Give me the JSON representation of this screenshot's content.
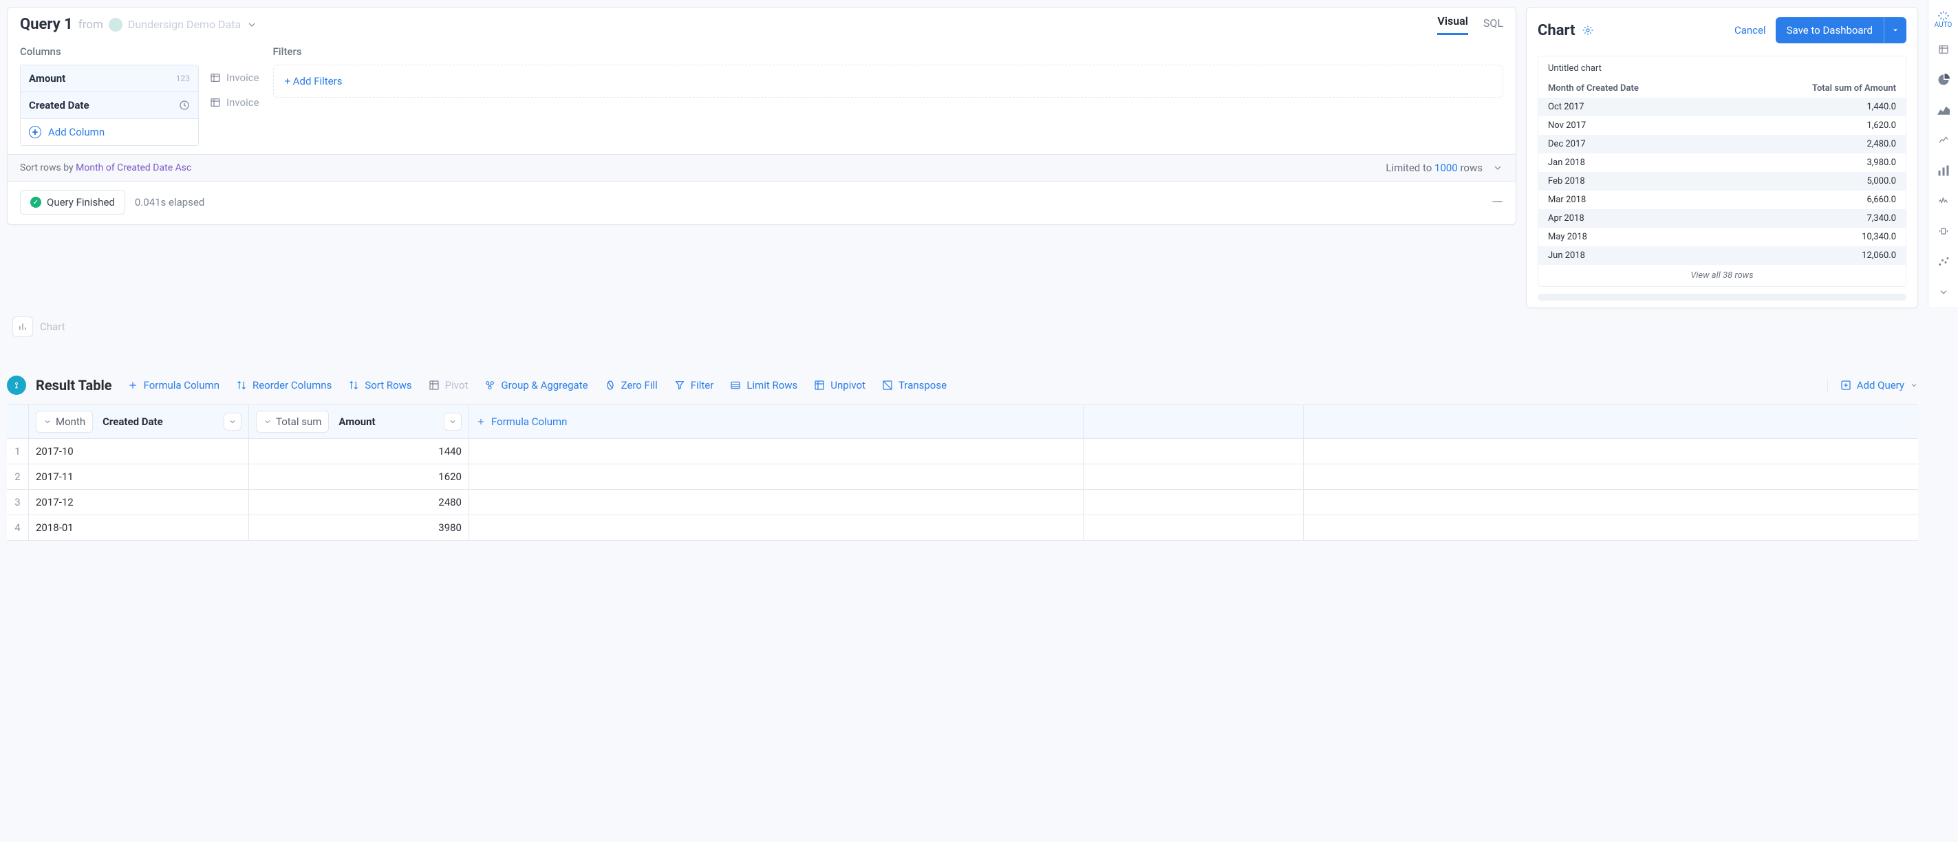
{
  "query_panel": {
    "title": "Query 1",
    "from_label": "from",
    "source": "Dundersign Demo Data",
    "tabs": {
      "visual": "Visual",
      "sql": "SQL"
    },
    "columns_label": "Columns",
    "filters_label": "Filters",
    "add_filters": "+ Add Filters",
    "columns": [
      {
        "name": "Amount",
        "type": "123",
        "table": "Invoice"
      },
      {
        "name": "Created Date",
        "type": "clock",
        "table": "Invoice"
      }
    ],
    "add_column": "Add Column",
    "sort": {
      "prefix": "Sort rows by",
      "field": "Month of Created Date",
      "dir": "Asc"
    },
    "limit": {
      "prefix": "Limited to",
      "n": "1000",
      "suffix": "rows"
    },
    "status": {
      "text": "Query Finished",
      "elapsed": "0.041s elapsed"
    }
  },
  "chart_chip": {
    "label": "Chart"
  },
  "chart_panel": {
    "title": "Chart",
    "cancel": "Cancel",
    "save": "Save to Dashboard",
    "untitled": "Untitled chart",
    "col1": "Month of Created Date",
    "col2": "Total sum of Amount",
    "rows": [
      {
        "m": "Oct 2017",
        "v": "1,440.0"
      },
      {
        "m": "Nov 2017",
        "v": "1,620.0"
      },
      {
        "m": "Dec 2017",
        "v": "2,480.0"
      },
      {
        "m": "Jan 2018",
        "v": "3,980.0"
      },
      {
        "m": "Feb 2018",
        "v": "5,000.0"
      },
      {
        "m": "Mar 2018",
        "v": "6,660.0"
      },
      {
        "m": "Apr 2018",
        "v": "7,340.0"
      },
      {
        "m": "May 2018",
        "v": "10,340.0"
      },
      {
        "m": "Jun 2018",
        "v": "12,060.0"
      }
    ],
    "footer": "View all 38 rows"
  },
  "chart_data": {
    "type": "table",
    "title": "Untitled chart",
    "columns": [
      "Month of Created Date",
      "Total sum of Amount"
    ],
    "rows": [
      [
        "Oct 2017",
        1440.0
      ],
      [
        "Nov 2017",
        1620.0
      ],
      [
        "Dec 2017",
        2480.0
      ],
      [
        "Jan 2018",
        3980.0
      ],
      [
        "Feb 2018",
        5000.0
      ],
      [
        "Mar 2018",
        6660.0
      ],
      [
        "Apr 2018",
        7340.0
      ],
      [
        "May 2018",
        10340.0
      ],
      [
        "Jun 2018",
        12060.0
      ]
    ],
    "total_rows": 38
  },
  "right_rail": {
    "auto": "AUTO"
  },
  "result_table": {
    "title": "Result Table",
    "actions": {
      "formula_column": "Formula Column",
      "reorder": "Reorder Columns",
      "sort": "Sort Rows",
      "pivot": "Pivot",
      "group": "Group & Aggregate",
      "zero": "Zero Fill",
      "filter": "Filter",
      "limit": "Limit Rows",
      "unpivot": "Unpivot",
      "transpose": "Transpose",
      "add_query": "Add Query"
    },
    "head": {
      "month_pill": "Month",
      "created_date": "Created Date",
      "total_sum_pill": "Total sum",
      "amount": "Amount",
      "formula": "Formula Column"
    },
    "rows": [
      {
        "i": "1",
        "m": "2017-10",
        "v": "1440"
      },
      {
        "i": "2",
        "m": "2017-11",
        "v": "1620"
      },
      {
        "i": "3",
        "m": "2017-12",
        "v": "2480"
      },
      {
        "i": "4",
        "m": "2018-01",
        "v": "3980"
      }
    ]
  }
}
